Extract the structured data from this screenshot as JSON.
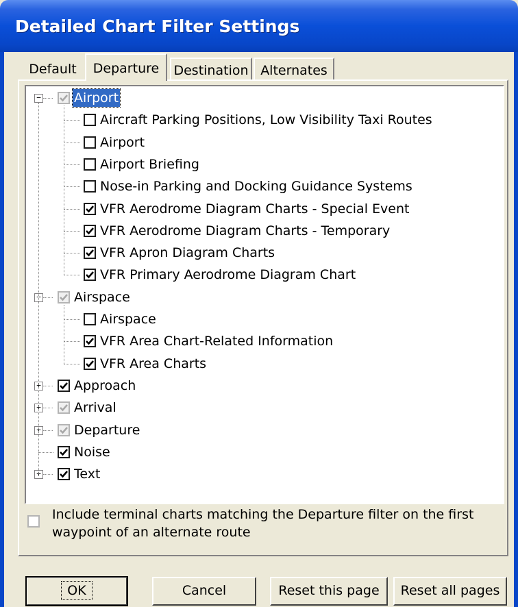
{
  "window": {
    "title": "Detailed Chart Filter Settings"
  },
  "tabs": [
    {
      "label": "Default",
      "active": false
    },
    {
      "label": "Departure",
      "active": true
    },
    {
      "label": "Destination",
      "active": false
    },
    {
      "label": "Alternates",
      "active": false
    }
  ],
  "tree": {
    "groups": [
      {
        "label": "Airport",
        "state": "partial",
        "expanded": true,
        "selected": true,
        "children": [
          {
            "label": "Aircraft Parking Positions, Low Visibility Taxi Routes",
            "checked": false
          },
          {
            "label": "Airport",
            "checked": false
          },
          {
            "label": "Airport Briefing",
            "checked": false
          },
          {
            "label": "Nose-in Parking and Docking Guidance Systems",
            "checked": false
          },
          {
            "label": "VFR Aerodrome Diagram Charts - Special Event",
            "checked": true
          },
          {
            "label": "VFR Aerodrome Diagram Charts - Temporary",
            "checked": true
          },
          {
            "label": "VFR Apron Diagram Charts",
            "checked": true
          },
          {
            "label": "VFR Primary Aerodrome Diagram Chart",
            "checked": true
          }
        ]
      },
      {
        "label": "Airspace",
        "state": "partial",
        "expanded": true,
        "children": [
          {
            "label": "Airspace",
            "checked": false
          },
          {
            "label": "VFR Area Chart-Related Information",
            "checked": true
          },
          {
            "label": "VFR Area Charts",
            "checked": true
          }
        ]
      },
      {
        "label": "Approach",
        "state": "checked",
        "expanded": false,
        "expandable": true
      },
      {
        "label": "Arrival",
        "state": "partial",
        "expanded": false,
        "expandable": true
      },
      {
        "label": "Departure",
        "state": "partial",
        "expanded": false,
        "expandable": true
      },
      {
        "label": "Noise",
        "state": "checked",
        "expanded": false,
        "expandable": false
      },
      {
        "label": "Text",
        "state": "checked",
        "expanded": false,
        "expandable": true
      }
    ]
  },
  "option": {
    "label": "Include terminal charts matching the Departure filter on the first waypoint of an alternate route",
    "checked": false
  },
  "buttons": {
    "ok": "OK",
    "cancel": "Cancel",
    "reset_page": "Reset this page",
    "reset_all": "Reset all pages"
  },
  "colors": {
    "titlebar": "#0846c8",
    "selection": "#316ac5",
    "dialog_bg": "#ece9d8"
  }
}
